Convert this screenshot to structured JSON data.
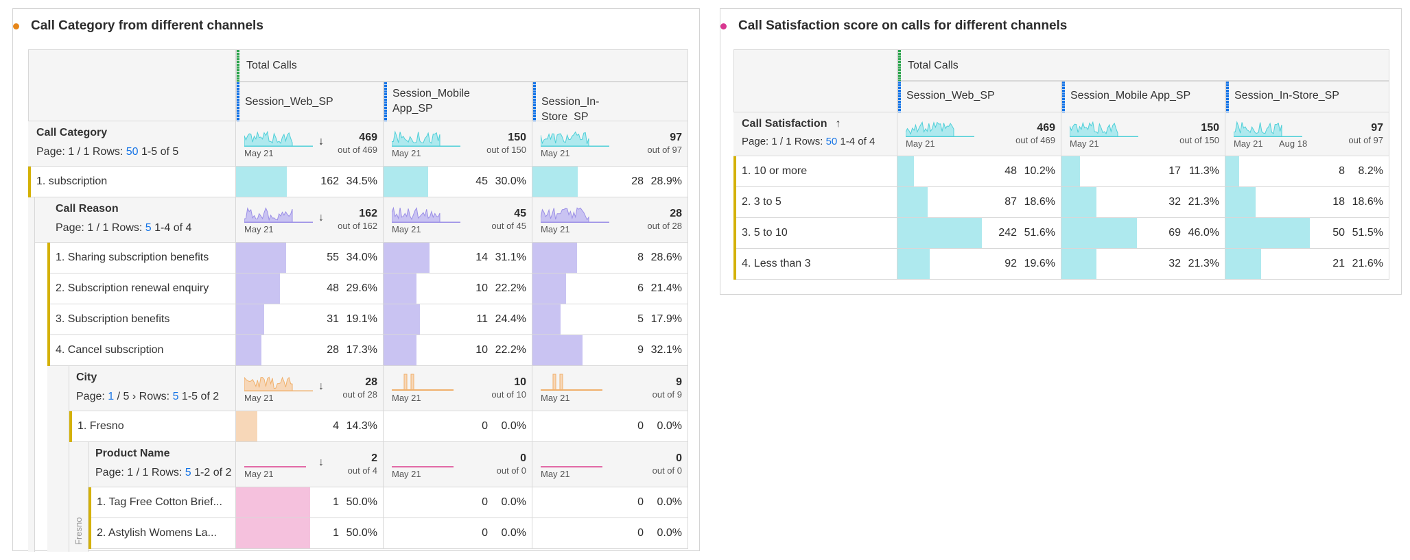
{
  "left_panel": {
    "title": "Call Category from different channels",
    "dot_color": "#e68619",
    "metric": "Total Calls",
    "columns": [
      "Session_Web_SP",
      "Session_Mobile App_SP",
      "Session_In-Store_SP"
    ],
    "call_category": {
      "label": "Call Category",
      "page_prefix": "Page:",
      "page": "1 / 1",
      "rows_label": "Rows:",
      "rows_value": "50",
      "range": "1-5 of 5",
      "sort_icon": "arrow-down-icon",
      "spark_date": "May 21",
      "totals": [
        {
          "value": "469",
          "of": "out of 469"
        },
        {
          "value": "150",
          "of": "out of 150"
        },
        {
          "value": "97",
          "of": "out of 97"
        }
      ],
      "row": {
        "label": "1.  subscription",
        "cells": [
          {
            "n": "162",
            "p": "34.5%",
            "f": 0.345
          },
          {
            "n": "45",
            "p": "30.0%",
            "f": 0.3
          },
          {
            "n": "28",
            "p": "28.9%",
            "f": 0.289
          }
        ]
      }
    },
    "call_reason": {
      "label": "Call Reason",
      "page_prefix": "Page:",
      "page": "1 / 1",
      "rows_label": "Rows:",
      "rows_value": "5",
      "range": "1-4 of 4",
      "spark_date": "May 21",
      "totals": [
        {
          "value": "162",
          "of": "out of 162"
        },
        {
          "value": "45",
          "of": "out of 45"
        },
        {
          "value": "28",
          "of": "out of 28"
        }
      ],
      "rows": [
        {
          "label": "1.  Sharing subscription benefits",
          "cells": [
            {
              "n": "55",
              "p": "34.0%",
              "f": 0.34
            },
            {
              "n": "14",
              "p": "31.1%",
              "f": 0.311
            },
            {
              "n": "8",
              "p": "28.6%",
              "f": 0.286
            }
          ]
        },
        {
          "label": "2.  Subscription renewal enquiry",
          "cells": [
            {
              "n": "48",
              "p": "29.6%",
              "f": 0.296
            },
            {
              "n": "10",
              "p": "22.2%",
              "f": 0.222
            },
            {
              "n": "6",
              "p": "21.4%",
              "f": 0.214
            }
          ]
        },
        {
          "label": "3.  Subscription benefits",
          "cells": [
            {
              "n": "31",
              "p": "19.1%",
              "f": 0.191
            },
            {
              "n": "11",
              "p": "24.4%",
              "f": 0.244
            },
            {
              "n": "5",
              "p": "17.9%",
              "f": 0.179
            }
          ]
        },
        {
          "label": "4.  Cancel subscription",
          "cells": [
            {
              "n": "28",
              "p": "17.3%",
              "f": 0.173
            },
            {
              "n": "10",
              "p": "22.2%",
              "f": 0.222
            },
            {
              "n": "9",
              "p": "32.1%",
              "f": 0.321
            }
          ]
        }
      ]
    },
    "city": {
      "label": "City",
      "page_prefix": "Page:",
      "page_num": "1",
      "page_sep": "/ 5",
      "next_icon": "›",
      "rows_label": "Rows:",
      "rows_value": "5",
      "range": "1-5 of 2",
      "spark_date": "May 21",
      "totals": [
        {
          "value": "28",
          "of": "out of 28"
        },
        {
          "value": "10",
          "of": "out of 10"
        },
        {
          "value": "9",
          "of": "out of 9"
        }
      ],
      "row": {
        "label": "1.  Fresno",
        "cells": [
          {
            "n": "4",
            "p": "14.3%",
            "f": 0.143
          },
          {
            "n": "0",
            "p": "0.0%",
            "f": 0
          },
          {
            "n": "0",
            "p": "0.0%",
            "f": 0
          }
        ]
      }
    },
    "product": {
      "label": "Product Name",
      "page_prefix": "Page:",
      "page": "1 / 1",
      "rows_label": "Rows:",
      "rows_value": "5",
      "range": "1-2 of 2",
      "spark_date": "May 21",
      "side_label": "Fresno",
      "totals": [
        {
          "value": "2",
          "of": "out of 4"
        },
        {
          "value": "0",
          "of": "out of 0"
        },
        {
          "value": "0",
          "of": "out of 0"
        }
      ],
      "rows": [
        {
          "label": "1.  Tag Free Cotton Brief...",
          "cells": [
            {
              "n": "1",
              "p": "50.0%",
              "f": 0.5
            },
            {
              "n": "0",
              "p": "0.0%",
              "f": 0
            },
            {
              "n": "0",
              "p": "0.0%",
              "f": 0
            }
          ]
        },
        {
          "label": "2.  Astylish Womens La...",
          "cells": [
            {
              "n": "1",
              "p": "50.0%",
              "f": 0.5
            },
            {
              "n": "0",
              "p": "0.0%",
              "f": 0
            },
            {
              "n": "0",
              "p": "0.0%",
              "f": 0
            }
          ]
        }
      ]
    }
  },
  "right_panel": {
    "title": "Call Satisfaction score on calls for different channels",
    "dot_color": "#d83790",
    "metric": "Total Calls",
    "columns": [
      "Session_Web_SP",
      "Session_Mobile App_SP",
      "Session_In-Store_SP"
    ],
    "header": {
      "label": "Call Satisfaction",
      "sort_icon": "arrow-up-icon",
      "page_prefix": "Page:",
      "page": "1 / 1",
      "rows_label": "Rows:",
      "rows_value": "50",
      "range": "1-4 of 4",
      "spark_date": "May 21",
      "spark_date_end": "Aug 18",
      "totals": [
        {
          "value": "469",
          "of": "out of 469"
        },
        {
          "value": "150",
          "of": "out of 150"
        },
        {
          "value": "97",
          "of": "out of 97"
        }
      ]
    },
    "rows": [
      {
        "label": "1.  10 or more",
        "cells": [
          {
            "n": "48",
            "p": "10.2%",
            "f": 0.102
          },
          {
            "n": "17",
            "p": "11.3%",
            "f": 0.113
          },
          {
            "n": "8",
            "p": "8.2%",
            "f": 0.082
          }
        ]
      },
      {
        "label": "2.  3 to 5",
        "cells": [
          {
            "n": "87",
            "p": "18.6%",
            "f": 0.186
          },
          {
            "n": "32",
            "p": "21.3%",
            "f": 0.213
          },
          {
            "n": "18",
            "p": "18.6%",
            "f": 0.186
          }
        ]
      },
      {
        "label": "3.  5 to 10",
        "cells": [
          {
            "n": "242",
            "p": "51.6%",
            "f": 0.516
          },
          {
            "n": "69",
            "p": "46.0%",
            "f": 0.46
          },
          {
            "n": "50",
            "p": "51.5%",
            "f": 0.515
          }
        ]
      },
      {
        "label": "4.  Less than 3",
        "cells": [
          {
            "n": "92",
            "p": "19.6%",
            "f": 0.196
          },
          {
            "n": "32",
            "p": "21.3%",
            "f": 0.213
          },
          {
            "n": "21",
            "p": "21.6%",
            "f": 0.216
          }
        ]
      }
    ]
  },
  "colors": {
    "teal": "#aee9ee",
    "teal_line": "#4fcfd8",
    "purple": "#c9c3f2",
    "purple_line": "#9b8fe6",
    "peach": "#f7d7b8",
    "peach_line": "#f0b06c",
    "pink": "#f5c1dd",
    "pink_line": "#e26aa6"
  }
}
